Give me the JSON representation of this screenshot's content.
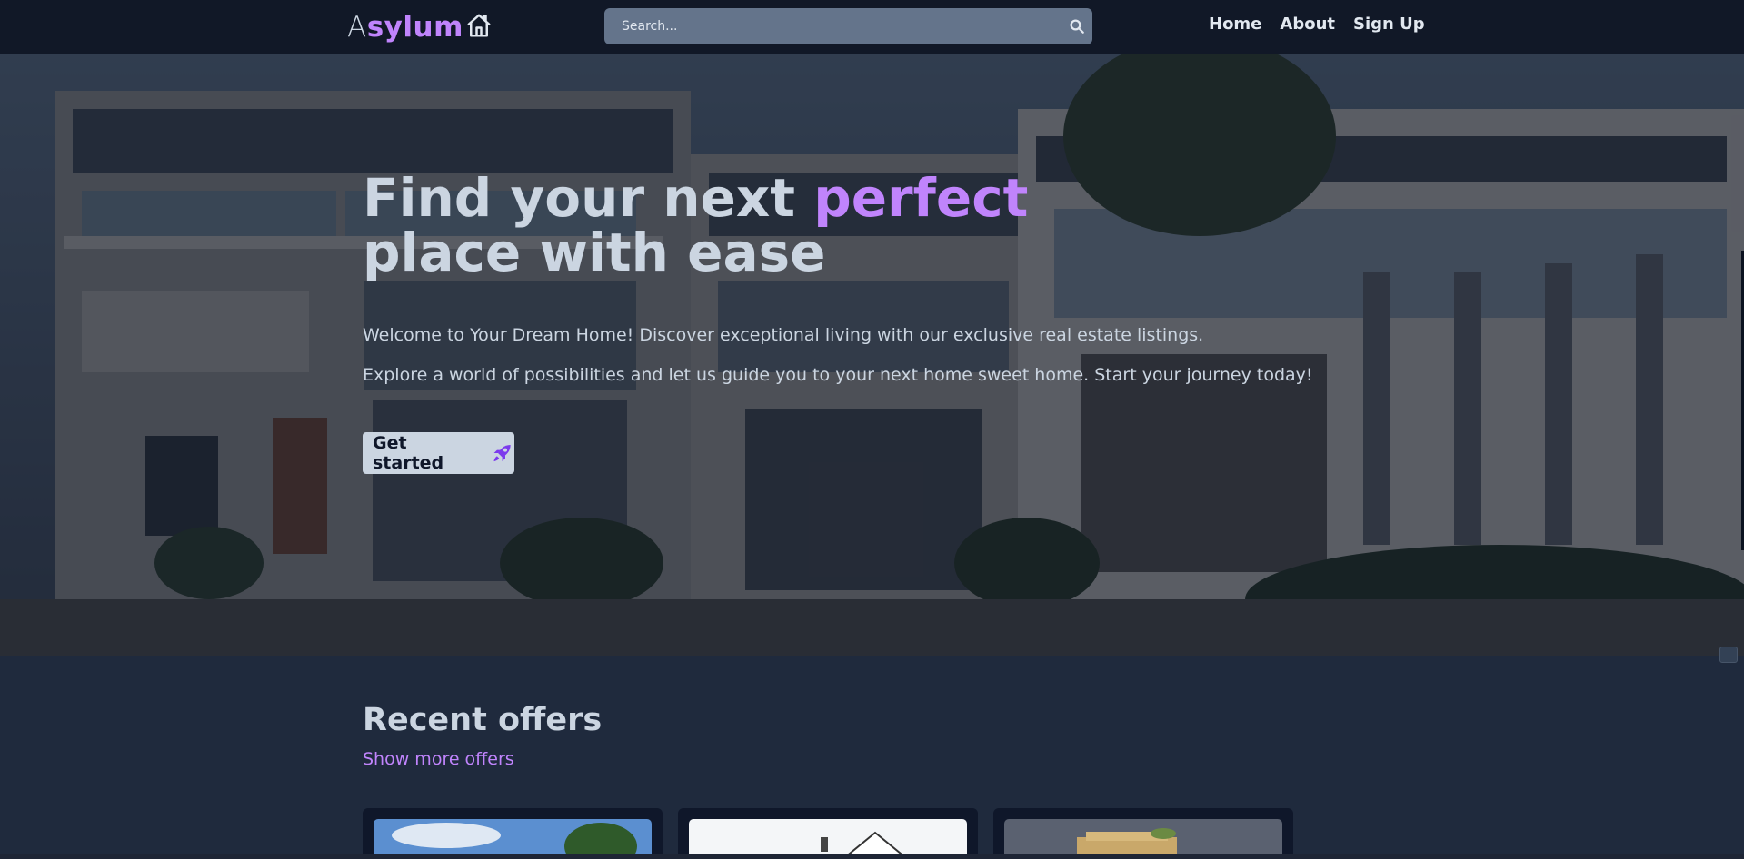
{
  "header": {
    "logo_first_letter": "A",
    "logo_rest": "sylum",
    "search_placeholder": "Search...",
    "nav": [
      {
        "label": "Home"
      },
      {
        "label": "About"
      },
      {
        "label": "Sign Up"
      }
    ]
  },
  "hero": {
    "title_part1": "Find your next ",
    "title_accent": "perfect",
    "title_part2": "place with ease",
    "paragraph1": "Welcome to Your Dream Home! Discover exceptional living with our exclusive real estate listings.",
    "paragraph2": "Explore a world of possibilities and let us guide you to your next home sweet home. Start your journey today!",
    "cta_label": "Get started"
  },
  "offers": {
    "title": "Recent offers",
    "link_label": "Show more offers"
  },
  "colors": {
    "accent": "#c084fc",
    "navbar_bg": "#111827",
    "page_bg": "#1f2a3d"
  },
  "icons": {
    "logo": "house-icon",
    "search": "search-icon",
    "cta": "rocket-icon"
  }
}
